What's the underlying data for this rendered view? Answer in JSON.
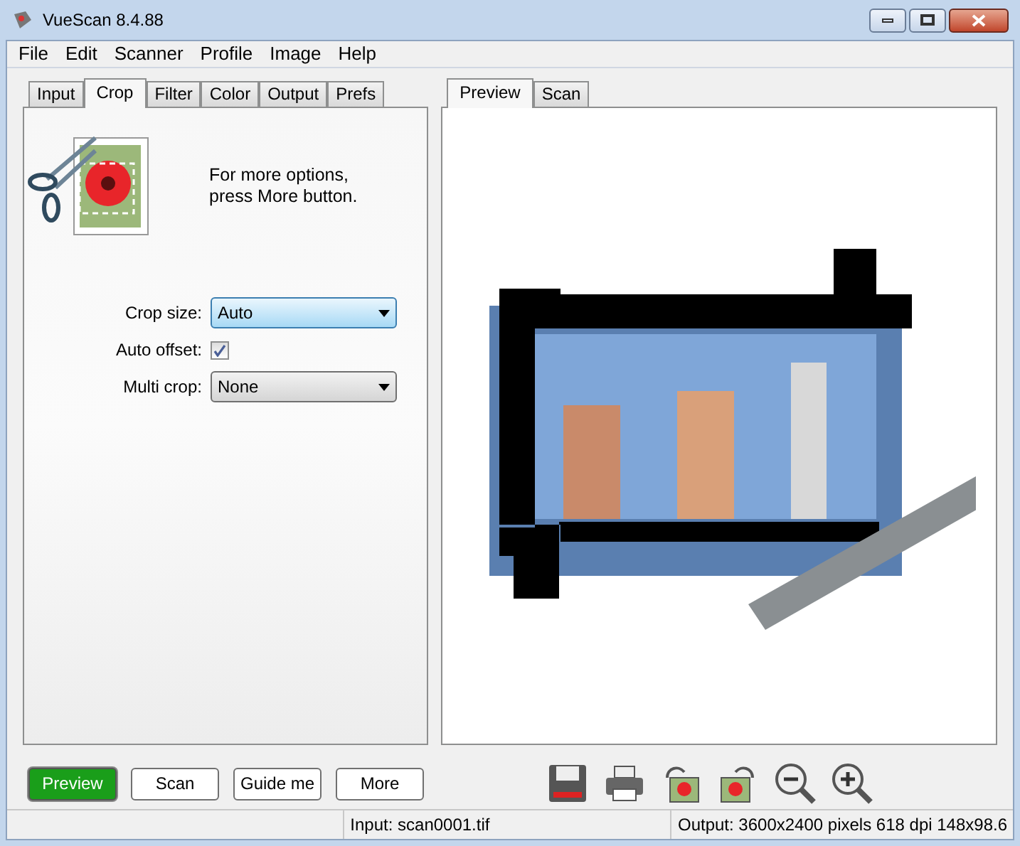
{
  "window": {
    "title": "VueScan 8.4.88"
  },
  "menu": [
    "File",
    "Edit",
    "Scanner",
    "Profile",
    "Image",
    "Help"
  ],
  "left_tabs": [
    {
      "label": "Input",
      "selected": false
    },
    {
      "label": "Crop",
      "selected": true
    },
    {
      "label": "Filter",
      "selected": false
    },
    {
      "label": "Color",
      "selected": false
    },
    {
      "label": "Output",
      "selected": false
    },
    {
      "label": "Prefs",
      "selected": false
    }
  ],
  "hint": [
    "For more options,",
    "press More button."
  ],
  "fields": [
    {
      "kind": "select",
      "label": "Crop size:",
      "value": "Auto",
      "focused": true
    },
    {
      "kind": "checkbox",
      "label": "Auto offset:",
      "checked": true
    },
    {
      "kind": "select",
      "label": "Multi crop:",
      "value": "None",
      "focused": false
    }
  ],
  "right_tabs": [
    {
      "label": "Preview",
      "selected": true
    },
    {
      "label": "Scan",
      "selected": false
    }
  ],
  "buttons": [
    {
      "label": "Preview",
      "highlighted": true
    },
    {
      "label": "Scan",
      "highlighted": false
    },
    {
      "label": "Guide me",
      "highlighted": false
    },
    {
      "label": "More",
      "highlighted": false
    }
  ],
  "status_bar": [
    "Input: scan0001.tif",
    "Output: 3600x2400 pixels 618 dpi 148x98.6"
  ]
}
